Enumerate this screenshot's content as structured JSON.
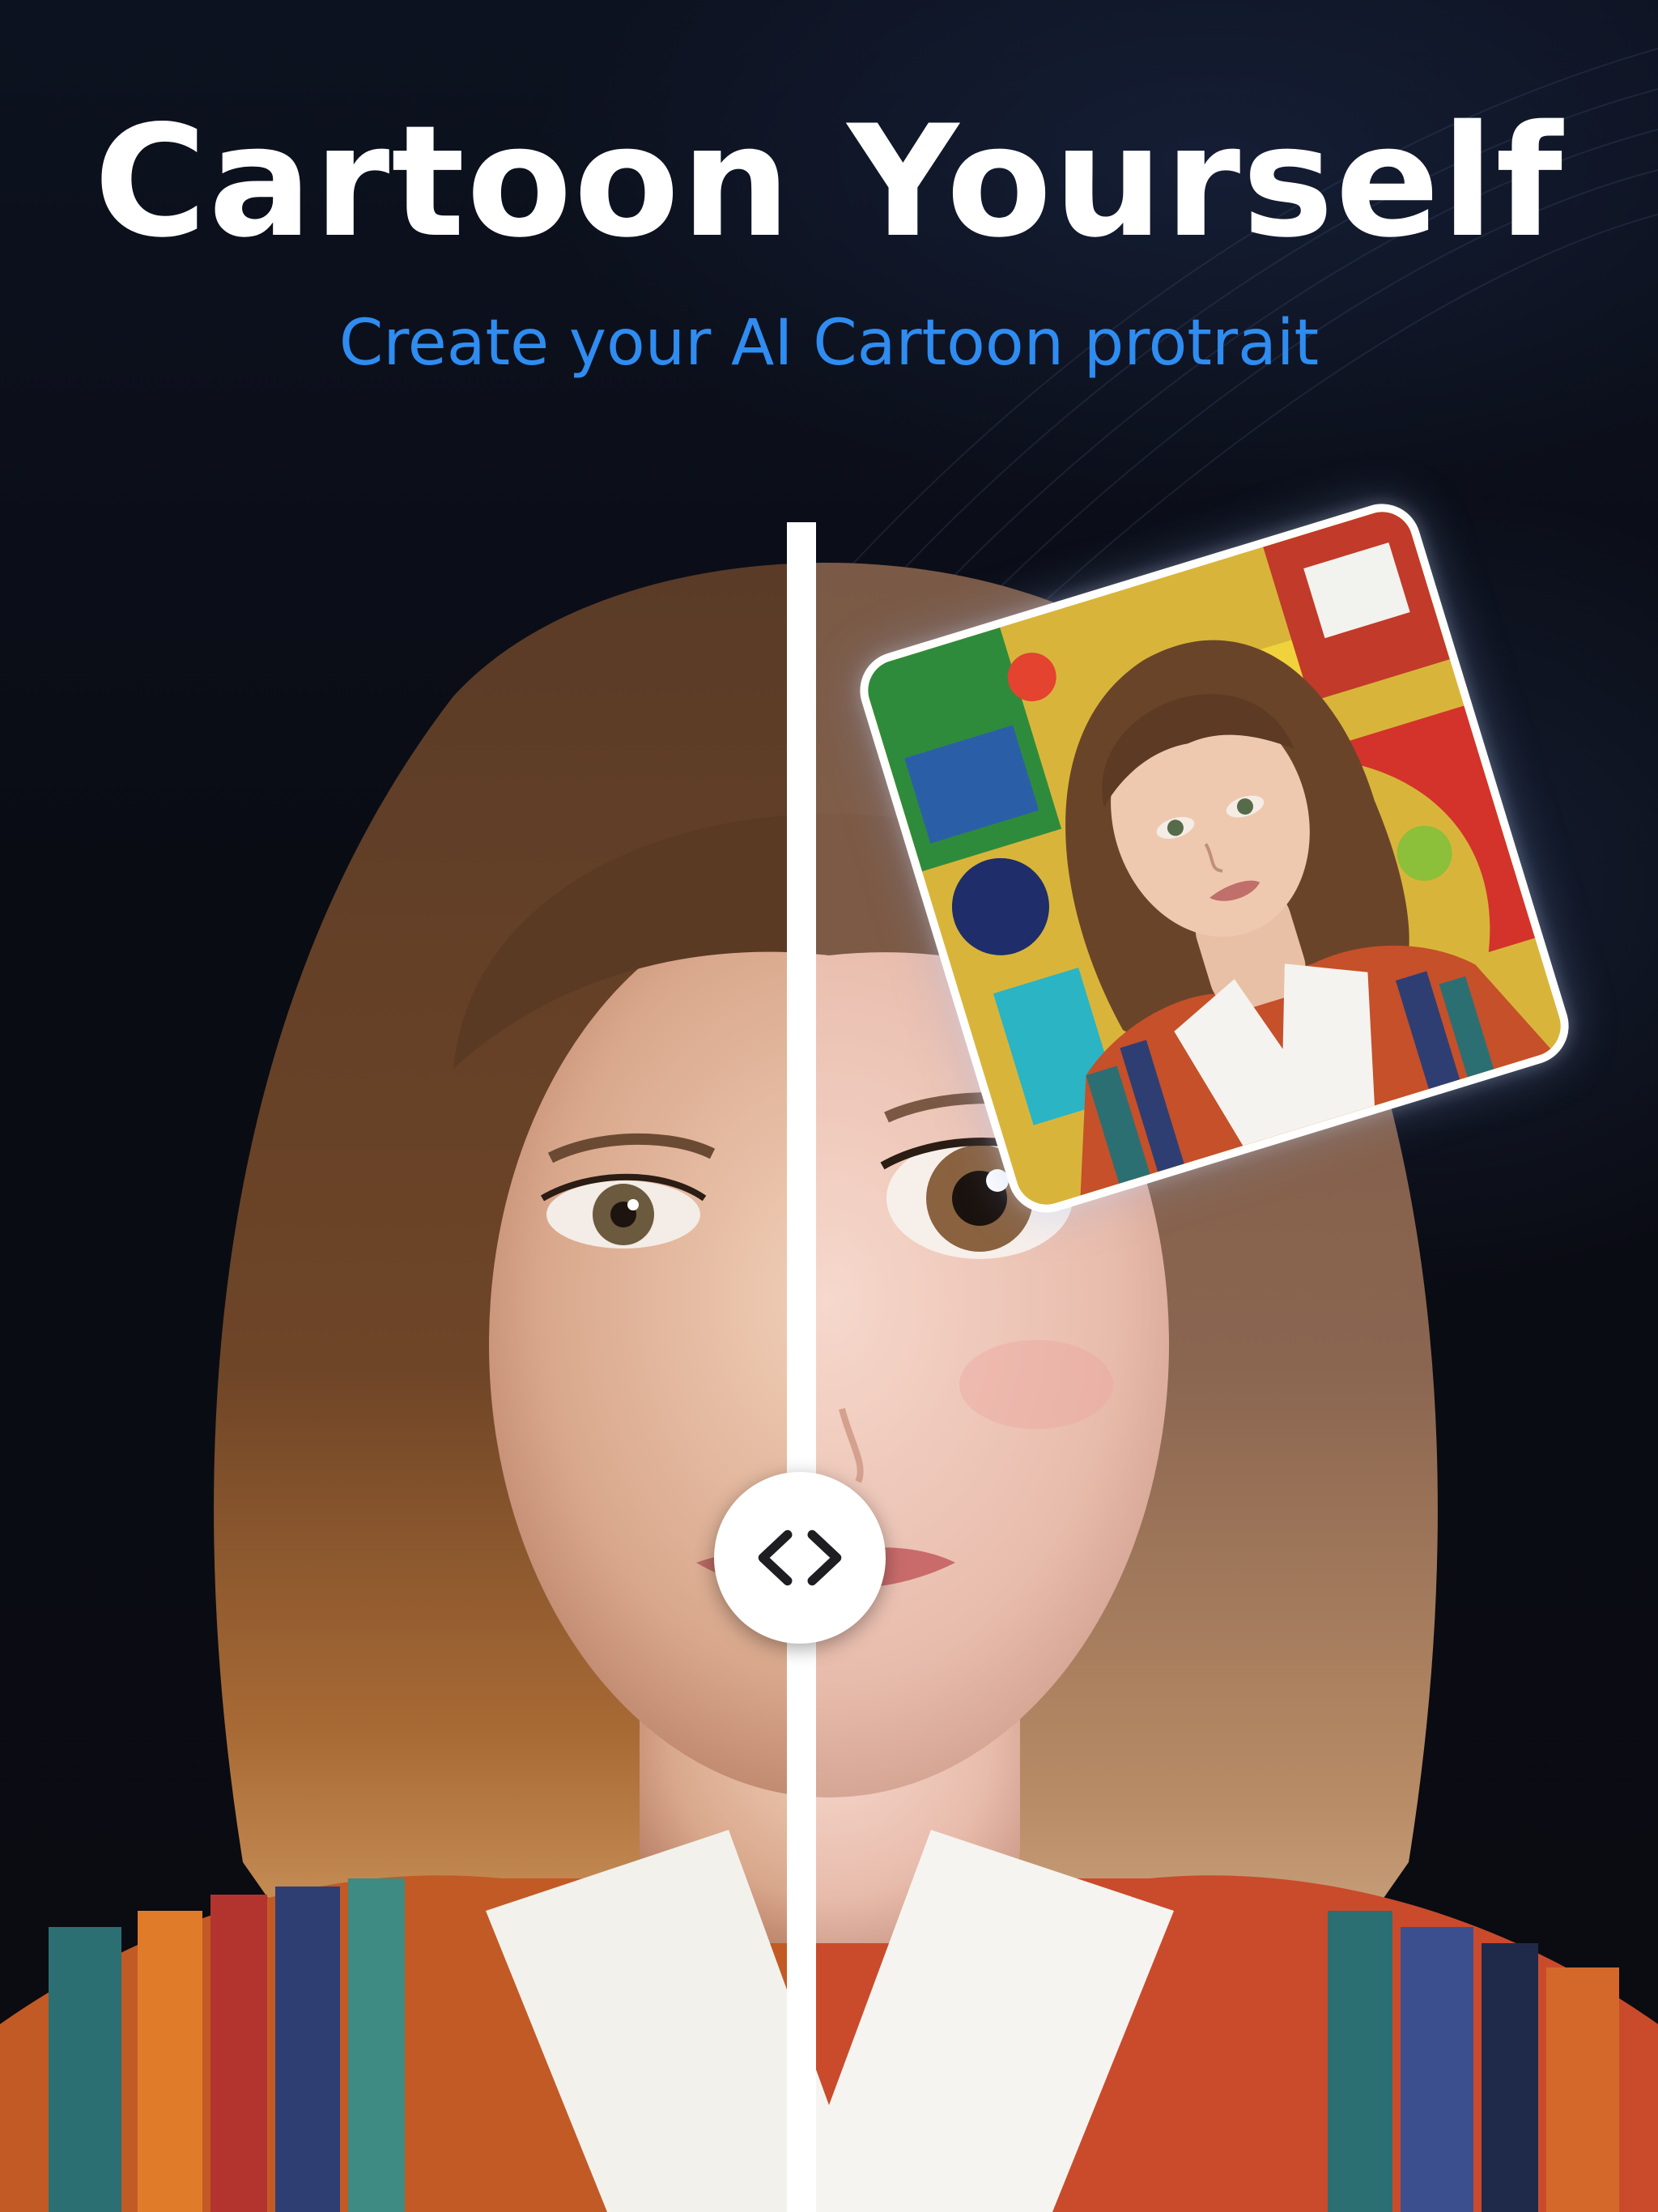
{
  "header": {
    "title": "Cartoon Yourself",
    "subtitle": "Create your AI Cartoon protrait"
  },
  "colors": {
    "background": "#0b0d14",
    "title": "#ffffff",
    "subtitle_accent": "#2f8cf0",
    "divider": "#ffffff"
  },
  "comparison": {
    "left_label": "original-photo",
    "right_label": "cartoon-result",
    "handle_icon": "chevron-left-right-icon"
  },
  "sample_card": {
    "icon": "sample-photo"
  }
}
